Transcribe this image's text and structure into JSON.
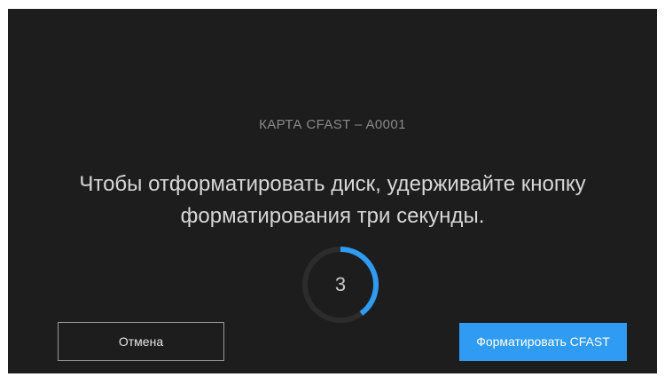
{
  "dialog": {
    "card_label": "КАРТА CFAST – A0001",
    "message_line1": "Чтобы отформатировать диск, удерживайте кнопку",
    "message_line2": "форматирования три секунды."
  },
  "countdown": {
    "value": "3",
    "progress_fraction": 0.4
  },
  "buttons": {
    "cancel_label": "Отмена",
    "format_label": "Форматировать CFAST"
  },
  "colors": {
    "background": "#1d1d1d",
    "accent": "#2f9bf3",
    "ring_track": "#2c2c2c"
  }
}
